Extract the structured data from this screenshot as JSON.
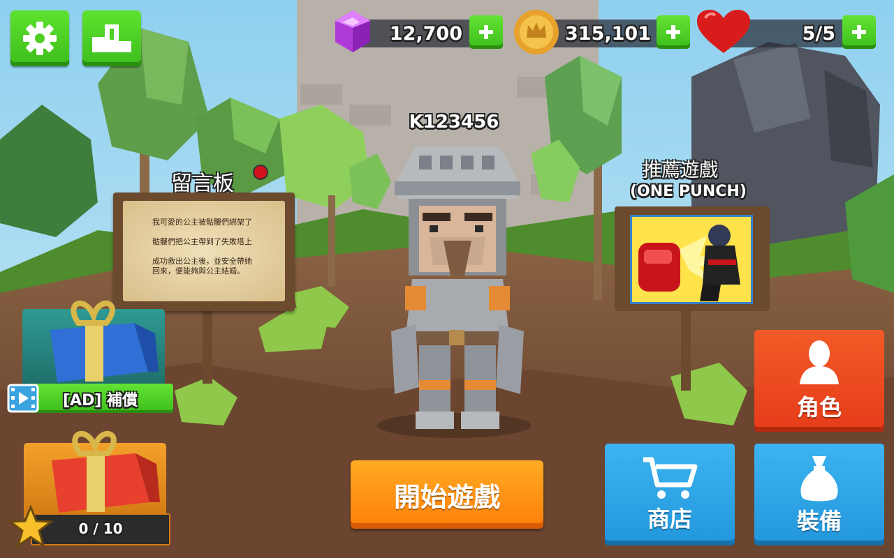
{
  "header": {
    "gems": "12,700",
    "coins": "315,101",
    "lives": "5/5"
  },
  "player": {
    "name": "K123456"
  },
  "board": {
    "title": "留言板",
    "lines": [
      "我可愛的公主被骷髏們綁架了",
      "骷髏們把公主帶到了失敗塔上",
      "成功救出公主後，並安全帶她",
      "回來，便能夠與公主結婚。"
    ]
  },
  "recommend": {
    "title": "推薦遊戲",
    "subtitle": "(ONE PUNCH)"
  },
  "gifts": {
    "ad_label": "[AD] 補償",
    "progress_label": "0 / 10",
    "progress": 0
  },
  "buttons": {
    "character": "角色",
    "shop": "商店",
    "equipment": "裝備",
    "start": "開始遊戲"
  },
  "colors": {
    "green": "#3cbd1c",
    "orange": "#ff7f0a",
    "red_button": "#ee4a1d",
    "blue_button": "#2aa4e8"
  },
  "icons": {
    "settings": "gear-icon",
    "leaderboard": "podium-icon",
    "gem": "gem-icon",
    "coin": "coin-icon",
    "heart": "heart-icon",
    "character": "person-icon",
    "shop": "cart-icon",
    "equipment": "bag-icon",
    "ad": "film-icon",
    "star": "star-icon"
  }
}
